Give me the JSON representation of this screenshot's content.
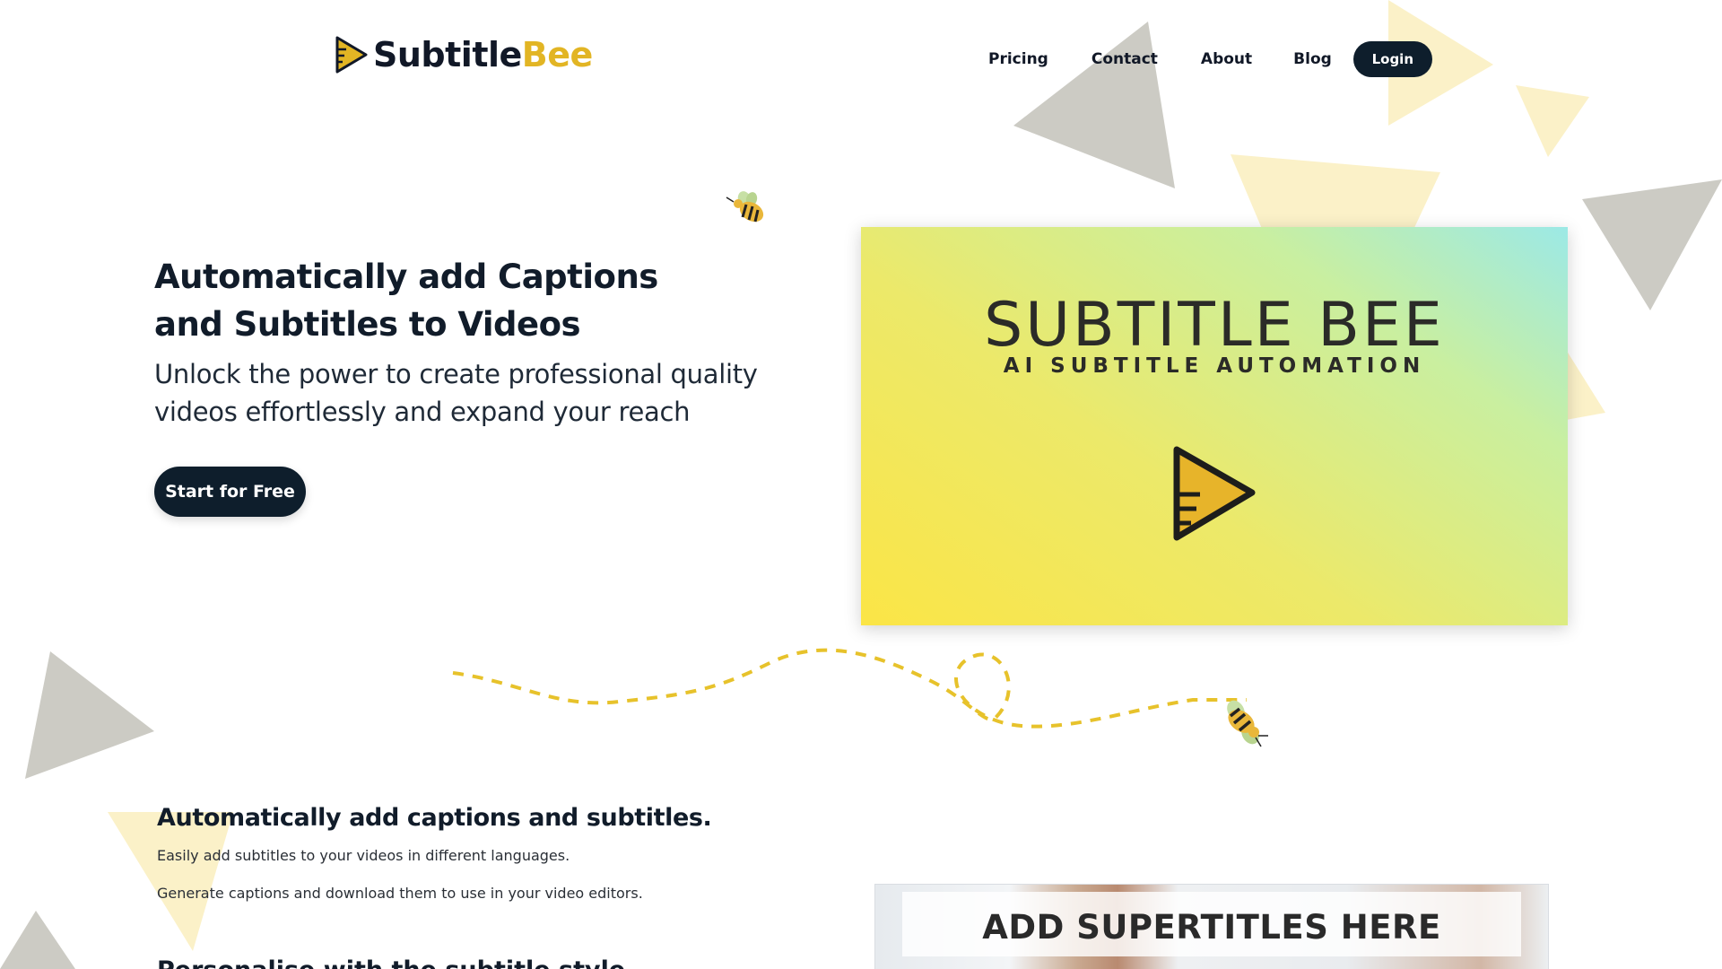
{
  "brand": {
    "name_part1": "Subtitle",
    "name_part2": "Bee",
    "primary_color": "#0e1e2c",
    "accent_color": "#e2b524"
  },
  "nav": {
    "links": [
      "Pricing",
      "Contact",
      "About",
      "Blog"
    ],
    "login_label": "Login"
  },
  "hero": {
    "title": "Automatically add Captions and Subtitles to Videos",
    "subtitle": "Unlock the power to create professional quality videos effortlessly and expand your reach",
    "cta_label": "Start for Free"
  },
  "video": {
    "title": "SUBTITLE BEE",
    "tagline": "AI SUBTITLE AUTOMATION",
    "play_icon": "play-icon"
  },
  "features": {
    "title": "Automatically add captions and subtitles.",
    "paragraph1": "Easily add subtitles to your videos in different languages.",
    "paragraph2": "Generate captions and download them to use in your video editors.",
    "next_title": "Personalise with the subtitle style"
  },
  "preview": {
    "text": "ADD SUPERTITLES HERE"
  }
}
